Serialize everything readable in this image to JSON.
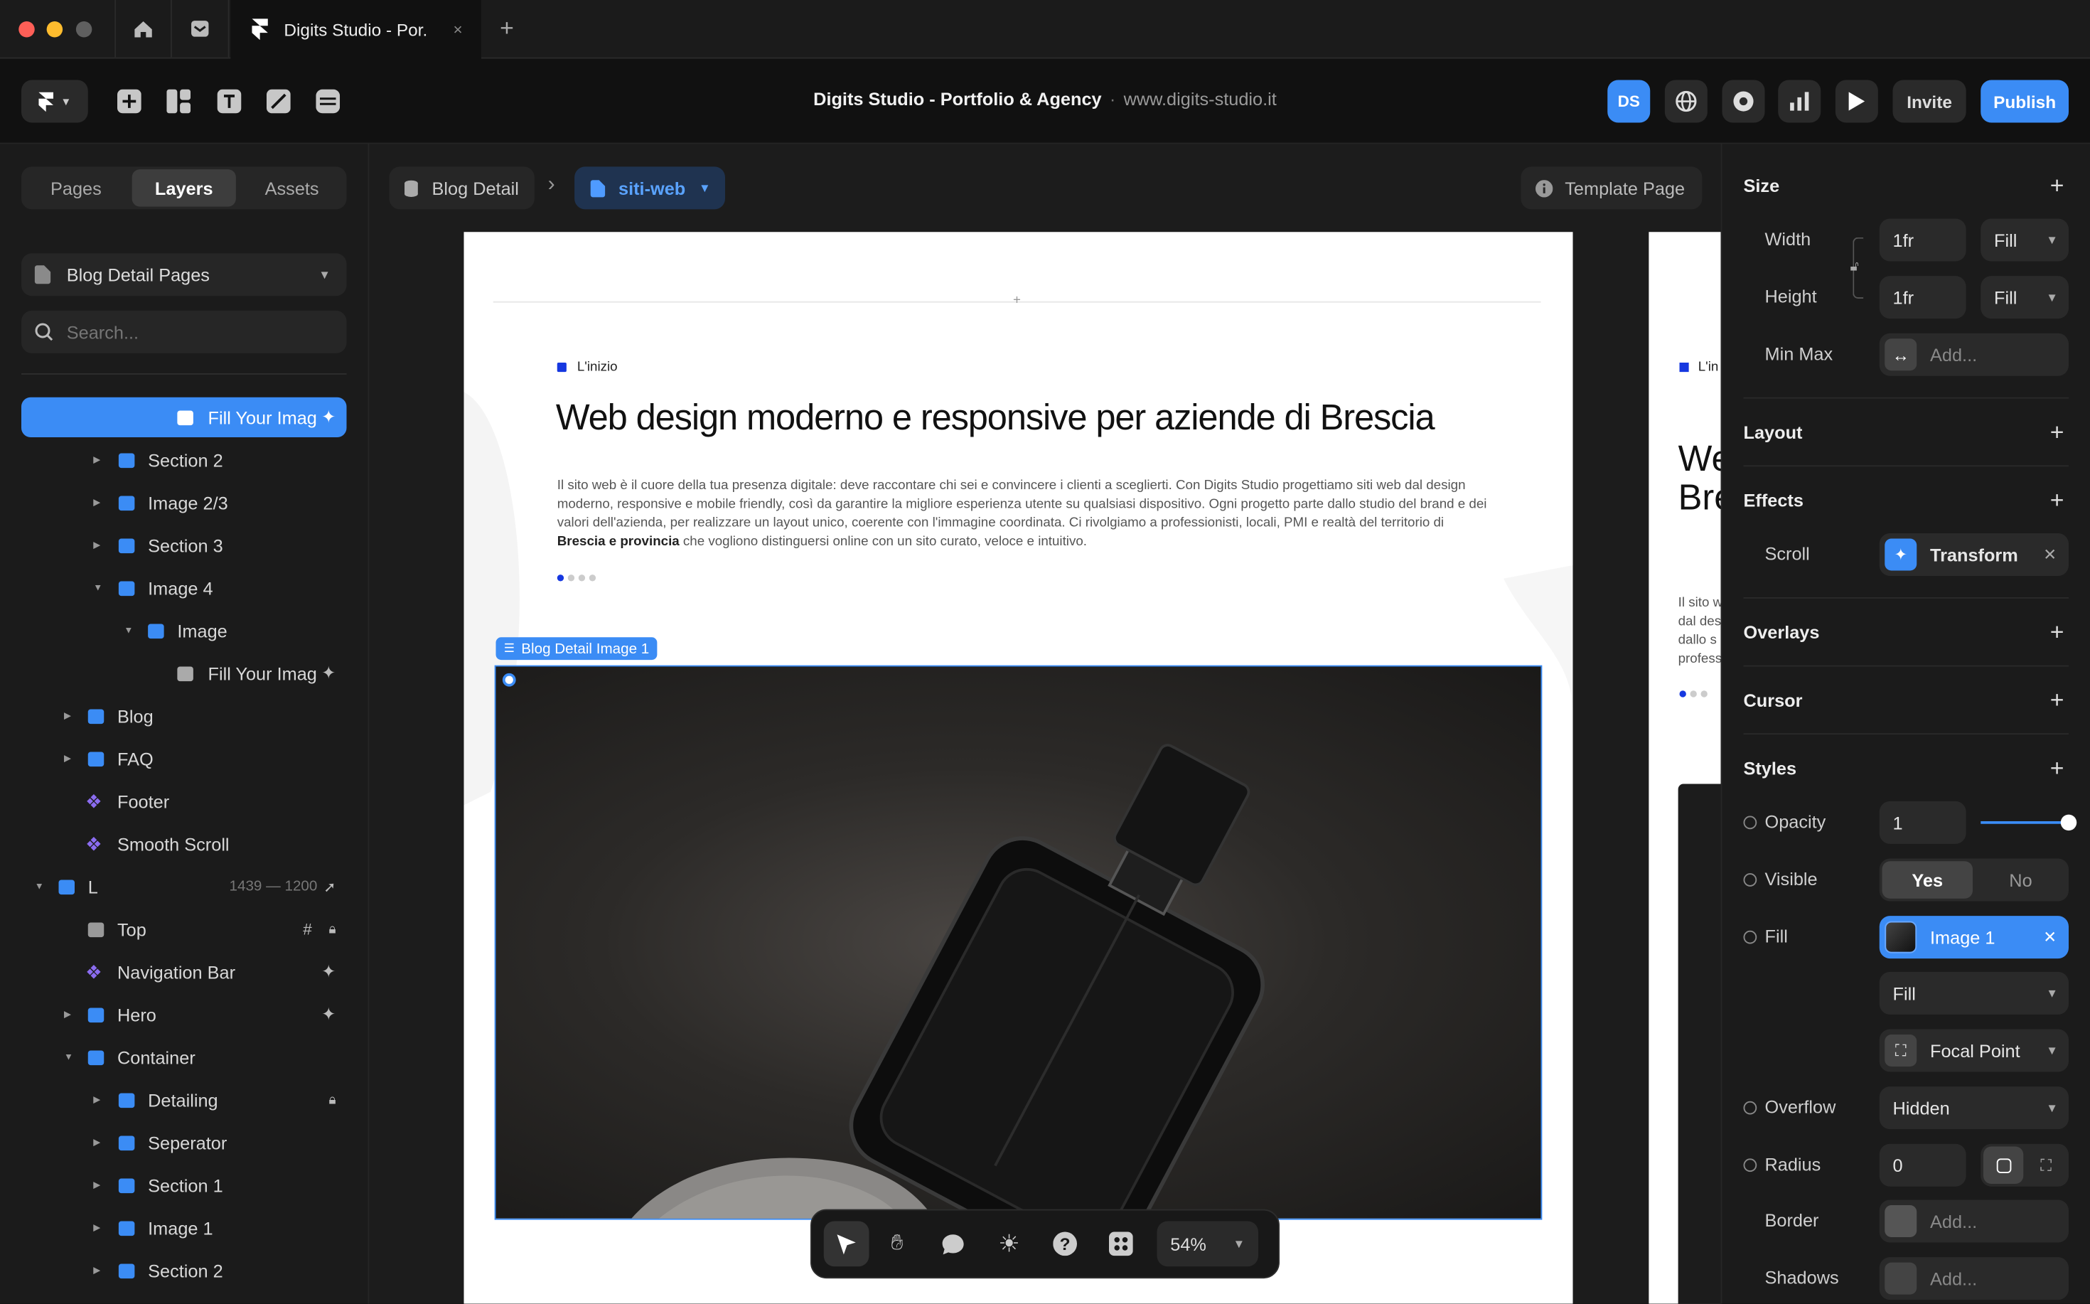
{
  "tabs": {
    "active_title": "Digits Studio - Por.",
    "new_tab": "+",
    "close": "×"
  },
  "toolbar": {
    "project_title": "Digits Studio - Portfolio & Agency",
    "separator": "·",
    "domain": "www.digits-studio.it",
    "avatar": "DS",
    "invite": "Invite",
    "publish": "Publish"
  },
  "left": {
    "tabs": [
      "Pages",
      "Layers",
      "Assets"
    ],
    "active_tab": "Layers",
    "page_select": "Blog Detail Pages",
    "search_placeholder": "Search...",
    "layers": [
      {
        "label": "Fill Your Imag",
        "selected": true
      },
      {
        "label": "Section 2"
      },
      {
        "label": "Image 2/3"
      },
      {
        "label": "Section 3"
      },
      {
        "label": "Image 4"
      },
      {
        "label": "Image"
      },
      {
        "label": "Fill Your Imag"
      },
      {
        "label": "Blog"
      },
      {
        "label": "FAQ"
      },
      {
        "label": "Footer"
      },
      {
        "label": "Smooth Scroll"
      },
      {
        "label": "L",
        "meta": "1439 — 1200"
      },
      {
        "label": "Top"
      },
      {
        "label": "Navigation Bar"
      },
      {
        "label": "Hero"
      },
      {
        "label": "Container"
      },
      {
        "label": "Detailing"
      },
      {
        "label": "Seperator"
      },
      {
        "label": "Section 1"
      },
      {
        "label": "Image 1"
      },
      {
        "label": "Section 2"
      }
    ]
  },
  "canvas": {
    "breadcrumb": [
      "Blog Detail",
      "siti-web"
    ],
    "breadcrumb_sep": "›",
    "template_label": "Template Page",
    "page": {
      "tag": "L'inizio",
      "heading": "Web design moderno e responsive per aziende di Brescia",
      "body_1": "Il sito web è il cuore della tua presenza digitale: deve raccontare chi sei e convincere i clienti a sceglierti. Con Digits Studio progettiamo siti web dal design moderno, responsive e mobile friendly, così da garantire la migliore esperienza utente su qualsiasi dispositivo. Ogni progetto parte dallo studio del brand e dei valori dell'azienda, per realizzare un layout unico, coerente con l'immagine coordinata. Ci rivolgiamo a professionisti, locali, PMI e realtà del territorio di ",
      "body_bold": "Brescia e provincia",
      "body_2": " che vogliono distinguersi online con un sito curato, veloce e intuitivo.",
      "selection_label": "Blog Detail Image 1"
    },
    "page2": {
      "tag": "L'in",
      "heading_1": "We",
      "heading_2": "Bre",
      "body": [
        "Il sito w",
        "dal des",
        "dallo s",
        "profess"
      ]
    },
    "zoom": "54%"
  },
  "right": {
    "size_title": "Size",
    "width_label": "Width",
    "width_value": "1fr",
    "width_mode": "Fill",
    "height_label": "Height",
    "height_value": "1fr",
    "height_mode": "Fill",
    "minmax_label": "Min Max",
    "minmax_placeholder": "Add...",
    "layout_title": "Layout",
    "effects_title": "Effects",
    "scroll_label": "Scroll",
    "scroll_value": "Transform",
    "overlays_title": "Overlays",
    "cursor_title": "Cursor",
    "styles_title": "Styles",
    "opacity_label": "Opacity",
    "opacity_value": "1",
    "opacity_fraction": 1,
    "visible_label": "Visible",
    "visible_yes": "Yes",
    "visible_no": "No",
    "fill_label": "Fill",
    "fill_value": "Image 1",
    "fill_mode": "Fill",
    "focal": "Focal Point",
    "overflow_label": "Overflow",
    "overflow_value": "Hidden",
    "radius_label": "Radius",
    "radius_value": "0",
    "border_label": "Border",
    "border_placeholder": "Add...",
    "shadows_label": "Shadows",
    "shadows_placeholder": "Add..."
  },
  "colors": {
    "accent": "#3b8cf5",
    "component": "#8b6cf0",
    "brand_blue": "#1638e0"
  }
}
